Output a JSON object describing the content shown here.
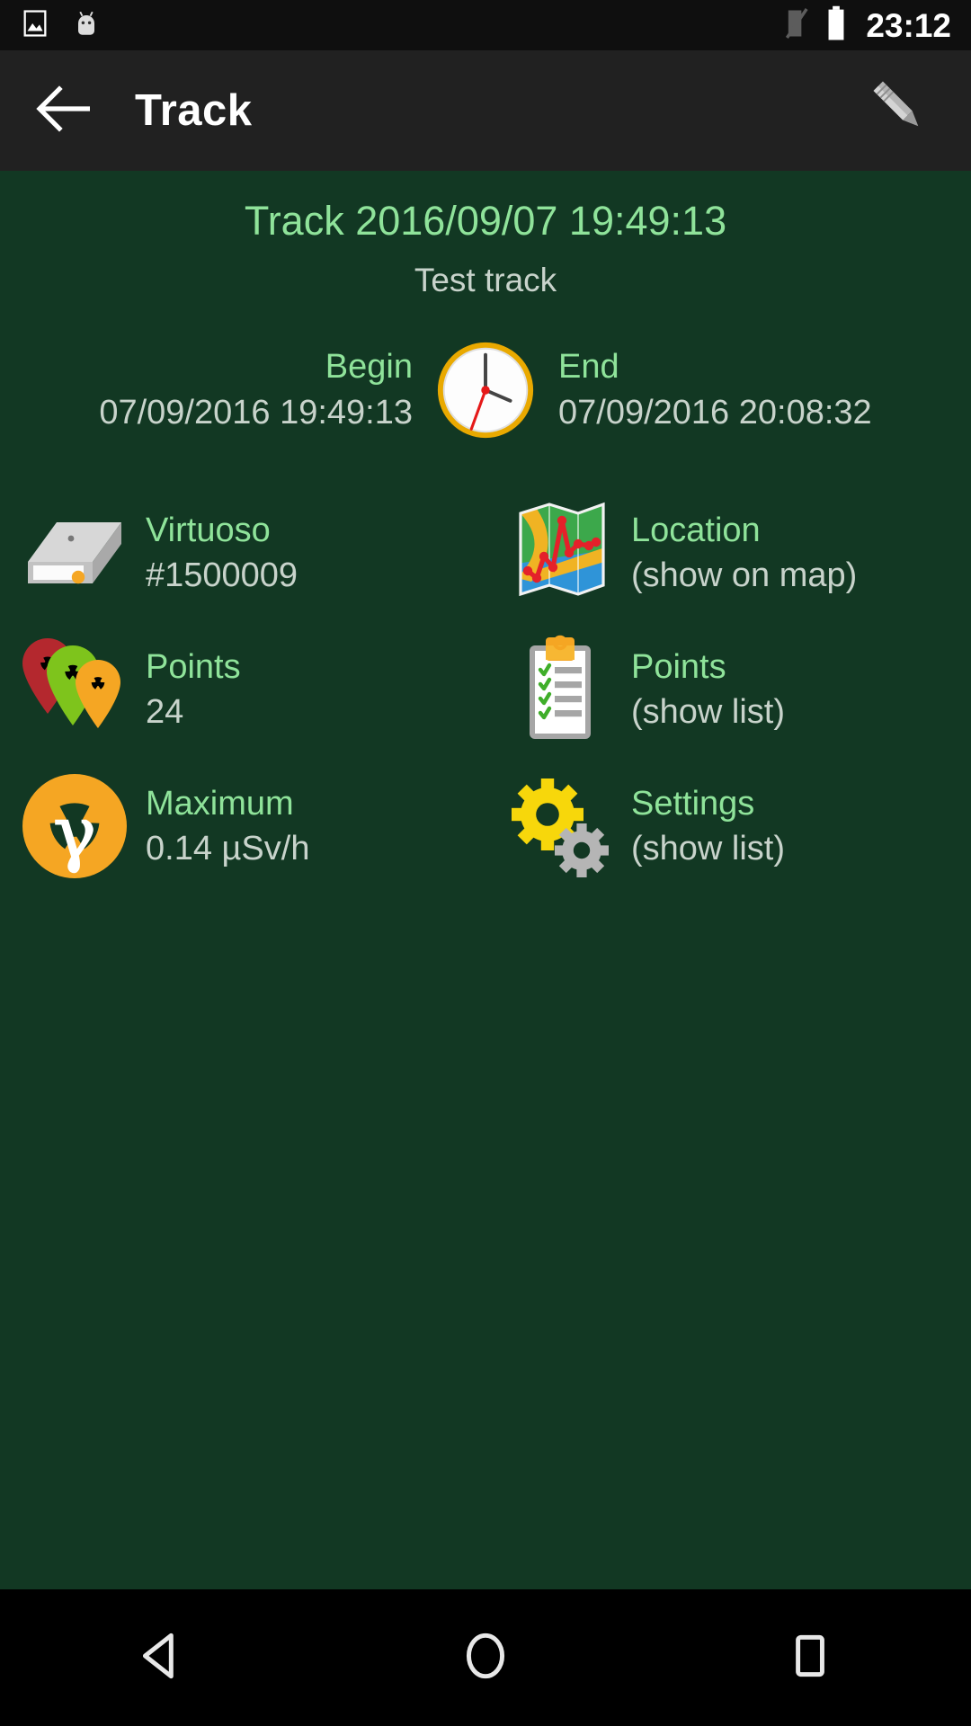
{
  "status_bar": {
    "icons": [
      "image-icon",
      "android-head-icon",
      "signal-off-icon",
      "battery-icon"
    ],
    "time": "23:12"
  },
  "action_bar": {
    "back_label": "back-arrow-icon",
    "title": "Track",
    "edit_label": "pencil-icon"
  },
  "track": {
    "title": "Track 2016/09/07 19:49:13",
    "subtitle": "Test track"
  },
  "time_row": {
    "begin_label": "Begin",
    "begin_value": "07/09/2016 19:49:13",
    "end_label": "End",
    "end_value": "07/09/2016 20:08:32",
    "clock_icon": "clock-icon"
  },
  "info_cells": [
    {
      "icon": "device-box-icon",
      "label": "Virtuoso",
      "value": "#1500009"
    },
    {
      "icon": "map-icon",
      "label": "Location",
      "value": "(show on map)"
    },
    {
      "icon": "radiation-pins-icon",
      "label": "Points",
      "value": "24"
    },
    {
      "icon": "clipboard-icon",
      "label": "Points",
      "value": "(show list)"
    },
    {
      "icon": "gamma-icon",
      "label": "Maximum",
      "value": "0.14 µSv/h"
    },
    {
      "icon": "gears-icon",
      "label": "Settings",
      "value": "(show list)"
    }
  ],
  "nav_bar": {
    "back": "nav-back-icon",
    "home": "nav-home-icon",
    "recents": "nav-recents-icon"
  },
  "colors": {
    "background": "#123823",
    "accent_green": "#8fe39a",
    "value_gray": "#c8d3cb",
    "action_bar": "#212121",
    "status_bar": "#0f0f0f",
    "orange": "#f5a623",
    "yellow": "#f7d70b"
  }
}
